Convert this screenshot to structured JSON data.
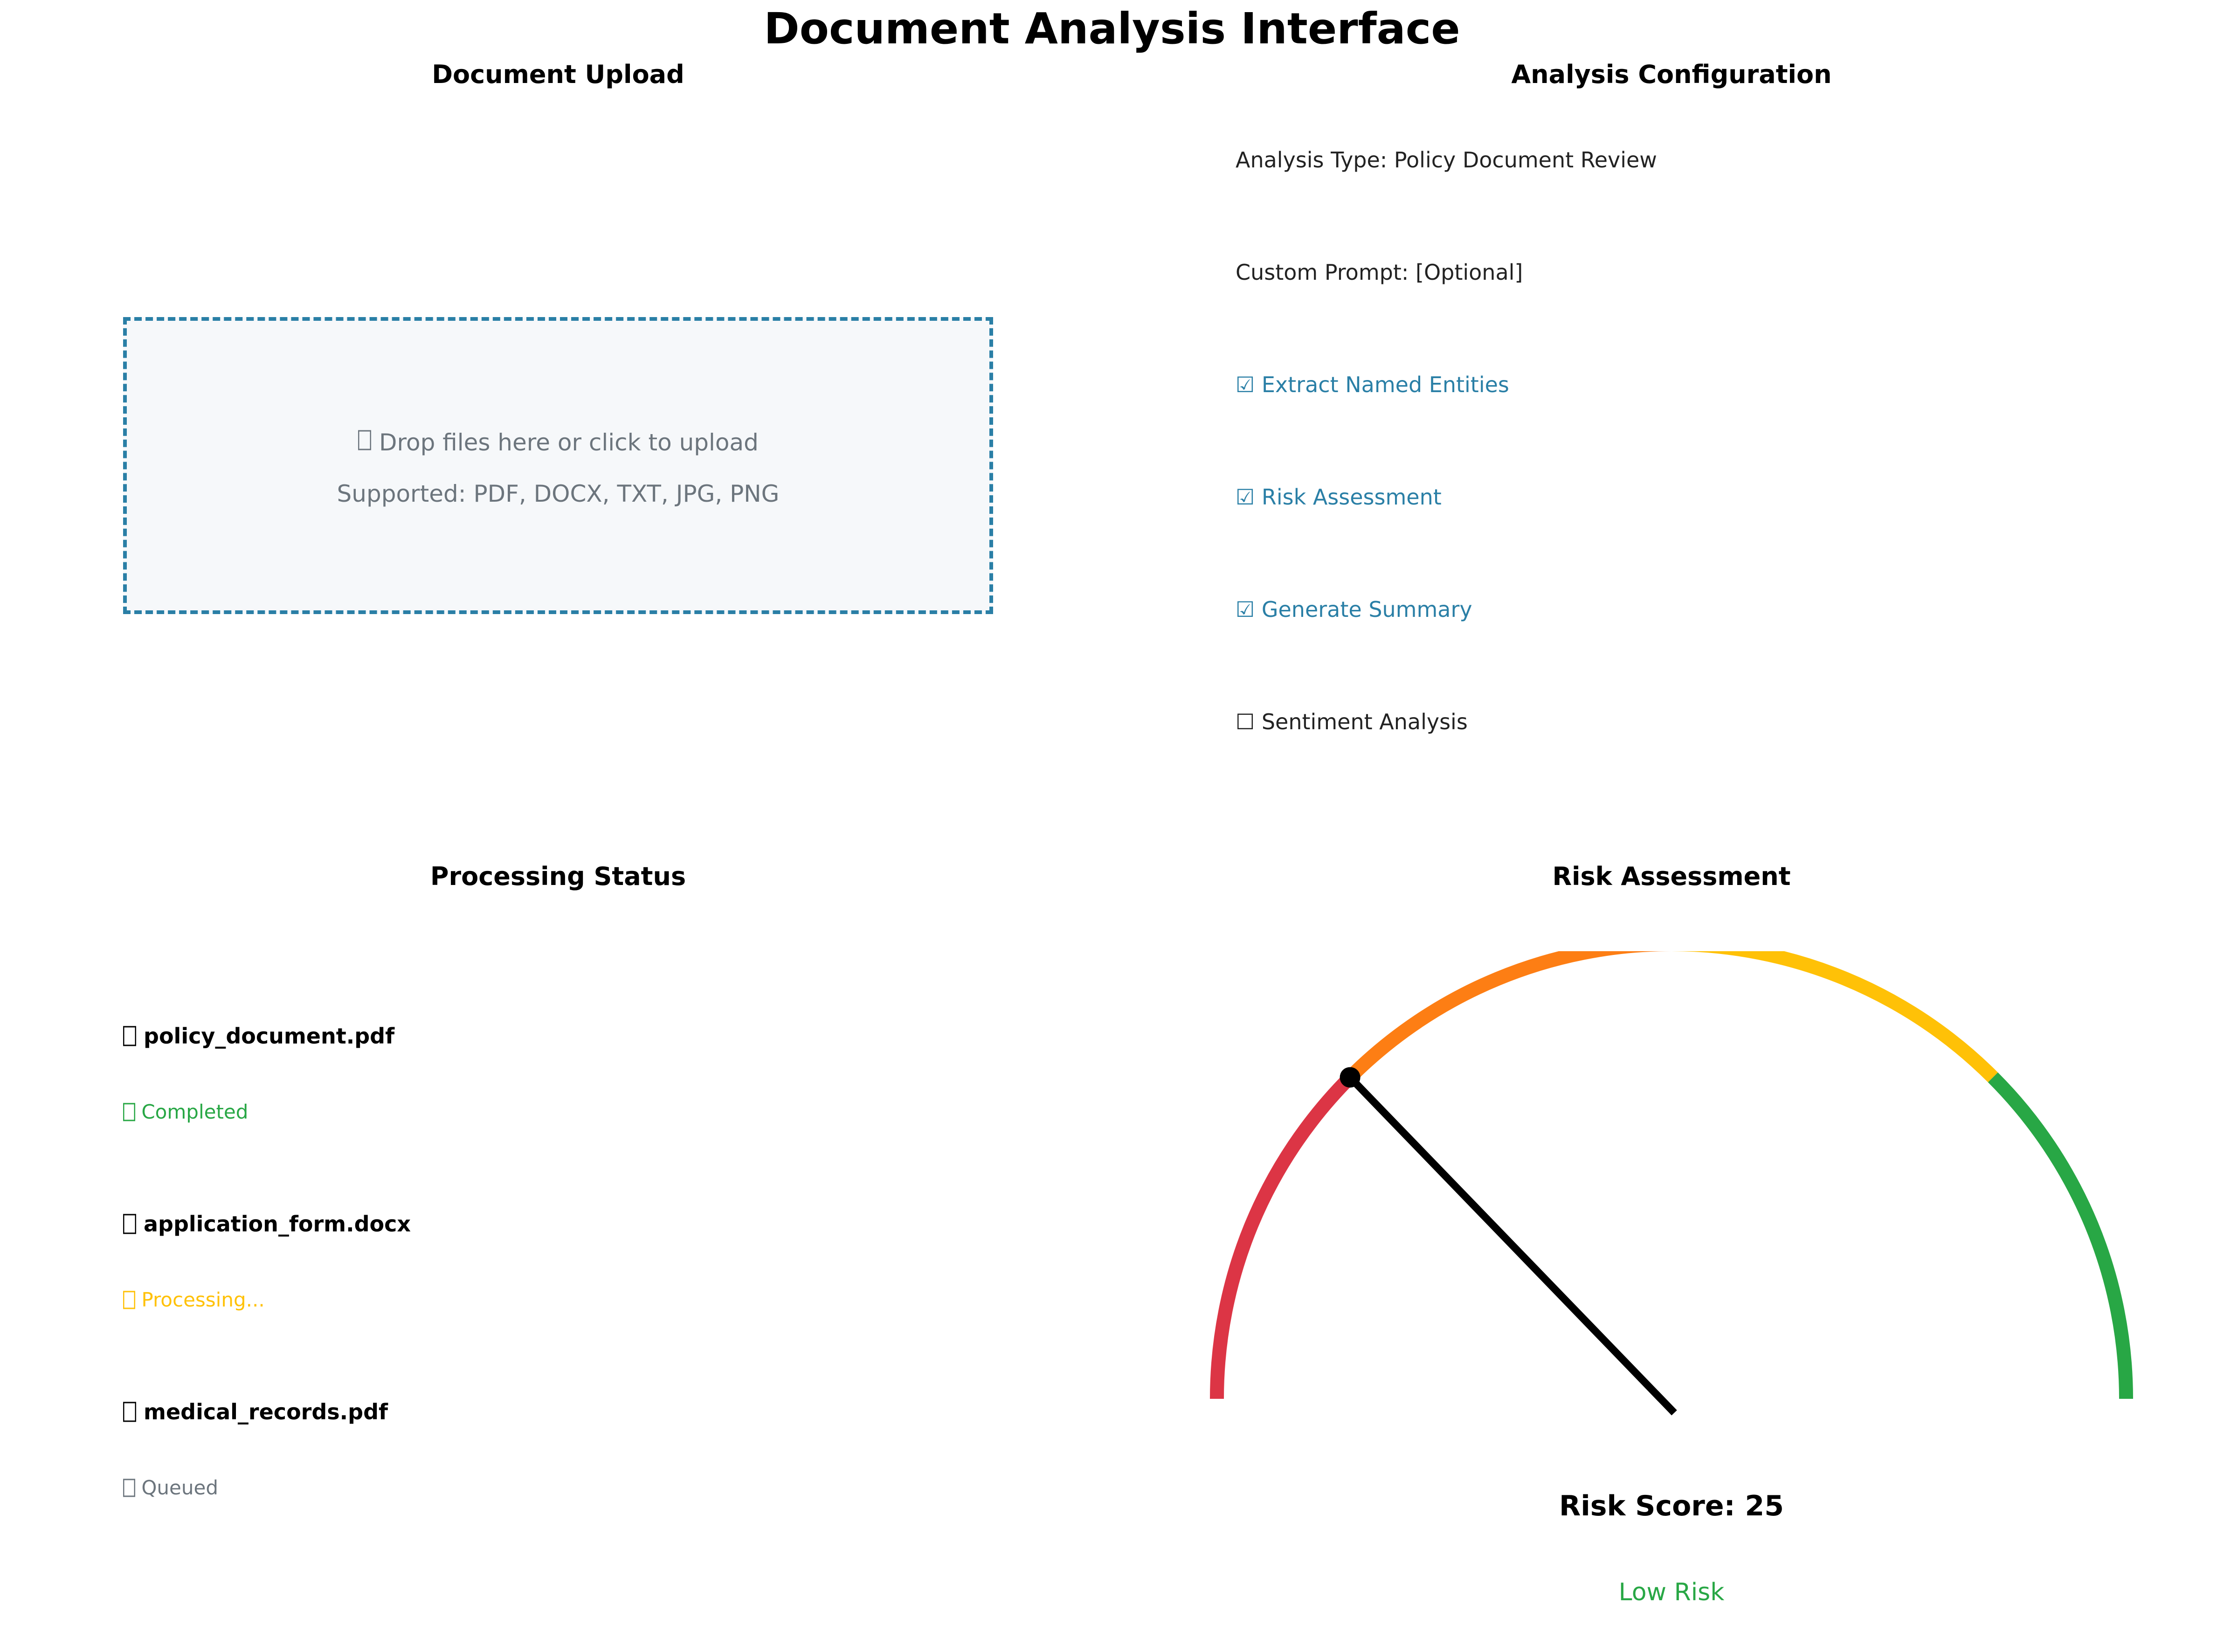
{
  "page": {
    "title": "Document Analysis Interface"
  },
  "upload": {
    "title": "Document Upload",
    "prompt_icon": "upload-icon",
    "prompt": "Drop files here or click to upload",
    "supported": "Supported: PDF, DOCX, TXT, JPG, PNG"
  },
  "config": {
    "title": "Analysis Configuration",
    "analysis_type": "Analysis Type: Policy Document Review",
    "custom_prompt": "Custom Prompt: [Optional]",
    "options": [
      {
        "label": "☑ Extract Named Entities",
        "checked": true
      },
      {
        "label": "☑ Risk Assessment",
        "checked": true
      },
      {
        "label": "☑ Generate Summary",
        "checked": true
      },
      {
        "label": "☐ Sentiment Analysis",
        "checked": false
      }
    ]
  },
  "processing": {
    "title": "Processing Status",
    "files": [
      {
        "icon": "document-icon",
        "name": "policy_document.pdf",
        "status_icon": "check-icon",
        "status": "Completed",
        "color": "#28a745"
      },
      {
        "icon": "document-icon",
        "name": "application_form.docx",
        "status_icon": "hourglass-icon",
        "status": "Processing...",
        "color": "#ffc107"
      },
      {
        "icon": "document-icon",
        "name": "medical_records.pdf",
        "status_icon": "clock-icon",
        "status": "Queued",
        "color": "#6c757d"
      }
    ]
  },
  "risk": {
    "title": "Risk Assessment",
    "score_text": "Risk Score: 25",
    "score": 25,
    "level": "Low Risk",
    "level_color": "#28a745",
    "gauge_colors": [
      "#dc3545",
      "#fd7e14",
      "#ffc107",
      "#28a745"
    ],
    "needle_color": "#000000"
  }
}
